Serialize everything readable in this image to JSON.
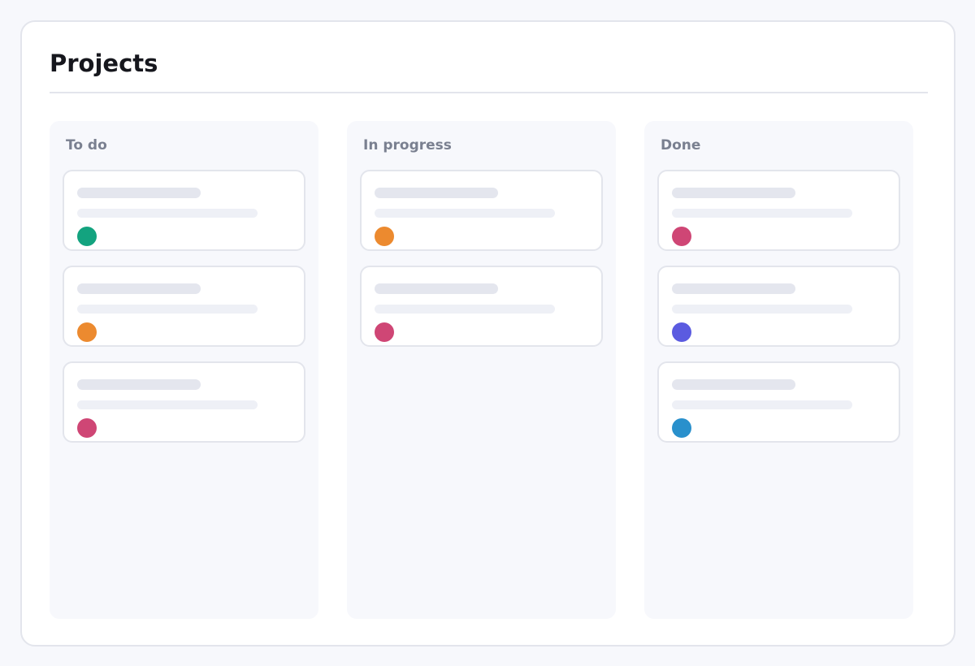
{
  "page": {
    "title": "Projects"
  },
  "board": {
    "columns": [
      {
        "title": "To do",
        "cards": [
          {
            "avatar_color": "#13a37f"
          },
          {
            "avatar_color": "#ec8a2f"
          },
          {
            "avatar_color": "#cf4675"
          }
        ]
      },
      {
        "title": "In progress",
        "cards": [
          {
            "avatar_color": "#ec8a2f"
          },
          {
            "avatar_color": "#cf4675"
          }
        ]
      },
      {
        "title": "Done",
        "cards": [
          {
            "avatar_color": "#cf4675"
          },
          {
            "avatar_color": "#5b5be0"
          },
          {
            "avatar_color": "#2990cc"
          }
        ]
      }
    ]
  }
}
